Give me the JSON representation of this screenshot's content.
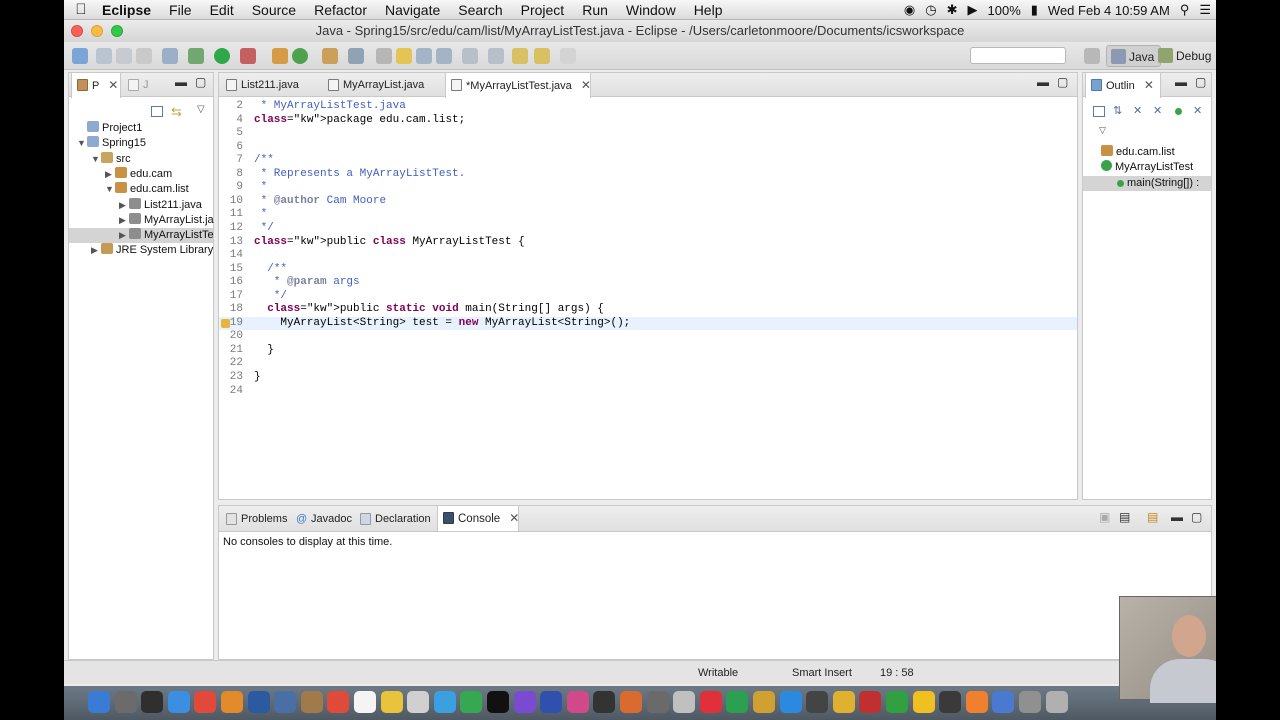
{
  "menubar": {
    "app": "Eclipse",
    "items": [
      "File",
      "Edit",
      "Source",
      "Refactor",
      "Navigate",
      "Search",
      "Project",
      "Run",
      "Window",
      "Help"
    ],
    "battery": "100%",
    "clock": "Wed Feb 4  10:59 AM"
  },
  "window": {
    "title": "Java - Spring15/src/edu/cam/list/MyArrayListTest.java - Eclipse - /Users/carletonmoore/Documents/icsworkspace"
  },
  "perspectives": [
    "Java",
    "Debug"
  ],
  "explorer": {
    "tabs": [
      "P",
      "J"
    ],
    "tree": [
      {
        "label": "Project1",
        "depth": 0,
        "expanded": null,
        "icon": "project-folder-icon"
      },
      {
        "label": "Spring15",
        "depth": 0,
        "expanded": true,
        "icon": "project-folder-icon"
      },
      {
        "label": "src",
        "depth": 1,
        "expanded": true,
        "icon": "source-folder-icon"
      },
      {
        "label": "edu.cam",
        "depth": 2,
        "expanded": false,
        "icon": "package-icon"
      },
      {
        "label": "edu.cam.list",
        "depth": 2,
        "expanded": true,
        "icon": "package-icon"
      },
      {
        "label": "List211.java",
        "depth": 3,
        "expanded": false,
        "icon": "java-file-icon"
      },
      {
        "label": "MyArrayList.ja",
        "depth": 3,
        "expanded": false,
        "icon": "java-file-icon"
      },
      {
        "label": "MyArrayListTe",
        "depth": 3,
        "expanded": false,
        "icon": "java-file-icon",
        "selected": true
      },
      {
        "label": "JRE System Library",
        "depth": 1,
        "expanded": false,
        "icon": "library-icon"
      }
    ]
  },
  "editor": {
    "tabs": [
      {
        "label": "List211.java",
        "active": false
      },
      {
        "label": "MyArrayList.java",
        "active": false
      },
      {
        "label": "*MyArrayListTest.java",
        "active": true
      }
    ],
    "lines": [
      {
        "n": "2",
        "text": " * MyArrayListTest.java"
      },
      {
        "n": "4",
        "text": "package edu.cam.list;"
      },
      {
        "n": "5",
        "text": ""
      },
      {
        "n": "6",
        "text": ""
      },
      {
        "n": "7",
        "text": "/**"
      },
      {
        "n": "8",
        "text": " * Represents a MyArrayListTest."
      },
      {
        "n": "9",
        "text": " *"
      },
      {
        "n": "10",
        "text": " * @author Cam Moore"
      },
      {
        "n": "11",
        "text": " *"
      },
      {
        "n": "12",
        "text": " */"
      },
      {
        "n": "13",
        "text": "public class MyArrayListTest {"
      },
      {
        "n": "14",
        "text": ""
      },
      {
        "n": "15",
        "text": "  /**"
      },
      {
        "n": "16",
        "text": "   * @param args"
      },
      {
        "n": "17",
        "text": "   */"
      },
      {
        "n": "18",
        "text": "  public static void main(String[] args) {"
      },
      {
        "n": "19",
        "text": "    MyArrayList<String> test = new MyArrayList<String>();"
      },
      {
        "n": "20",
        "text": ""
      },
      {
        "n": "21",
        "text": "  }"
      },
      {
        "n": "22",
        "text": ""
      },
      {
        "n": "23",
        "text": "}"
      },
      {
        "n": "24",
        "text": ""
      }
    ]
  },
  "outline": {
    "tab": "Outlin",
    "items": [
      {
        "label": "edu.cam.list",
        "icon": "package-icon"
      },
      {
        "label": "MyArrayListTest",
        "icon": "class-icon"
      },
      {
        "label": "main(String[]) :",
        "icon": "method-icon"
      }
    ]
  },
  "bottom": {
    "tabs": [
      "Problems",
      "Javadoc",
      "Declaration",
      "Console"
    ],
    "active": "Console",
    "message": "No consoles to display at this time."
  },
  "status": {
    "writable": "Writable",
    "insert": "Smart Insert",
    "position": "19 : 58"
  }
}
